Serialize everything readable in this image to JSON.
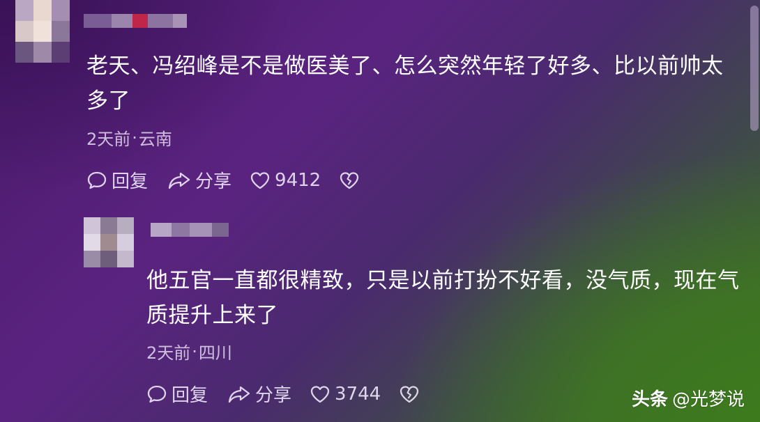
{
  "comments": [
    {
      "text": "老天、冯绍峰是不是做医美了、怎么突然年轻了好多、比以前帅太多了",
      "time": "2天前",
      "separator": "·",
      "location": "云南",
      "reply_label": "回复",
      "share_label": "分享",
      "likes": "9412"
    },
    {
      "text": "他五官一直都很精致，只是以前打扮不好看，没气质，现在气质提升上来了",
      "time": "2天前",
      "separator": "·",
      "location": "四川",
      "reply_label": "回复",
      "share_label": "分享",
      "likes": "3744"
    }
  ],
  "watermark": {
    "brand": "头条",
    "handle": "@光梦说"
  },
  "icons": {
    "reply": "reply-bubble-icon",
    "share": "share-arrow-icon",
    "like": "heart-icon",
    "dislike": "broken-heart-icon"
  },
  "colors": {
    "text": "#ffffff",
    "meta": "#ebe1f5",
    "bg_purple": "#5a2380",
    "bg_green": "#3e6b24"
  }
}
